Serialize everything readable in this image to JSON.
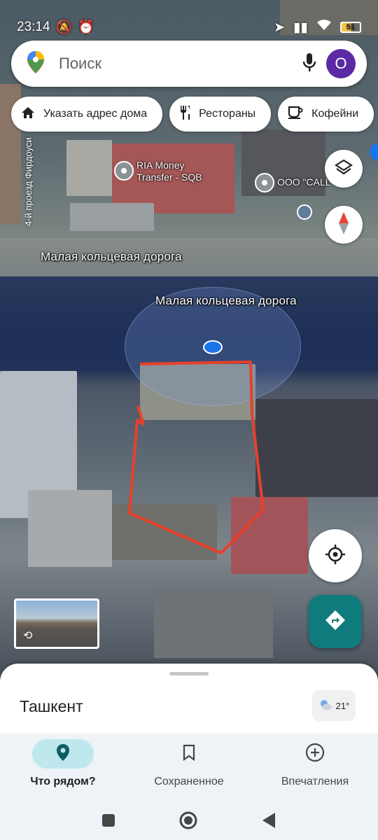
{
  "status_bar": {
    "time": "23:14",
    "battery": "51"
  },
  "search": {
    "placeholder": "Поиск",
    "avatar_letter": "O"
  },
  "chips": [
    {
      "label": "Указать адрес дома",
      "icon": "home-icon"
    },
    {
      "label": "Рестораны",
      "icon": "restaurant-icon"
    },
    {
      "label": "Кофейни",
      "icon": "coffee-icon"
    }
  ],
  "map": {
    "road_label_1": "Малая кольцевая дорога",
    "road_label_2": "Малая кольцевая дорога",
    "side_street": "4-й проезд Фирдоуси",
    "poi_1": "RIA Money Transfer - SQB",
    "poi_2": "ООО \"CALL",
    "colors": {
      "outline": "#e8402a",
      "route_button": "#0f7b7d",
      "location_dot": "#1a73e8"
    }
  },
  "sheet": {
    "city": "Ташкент",
    "temperature": "21°"
  },
  "bottom_nav": [
    {
      "label": "Что рядом?",
      "icon": "location-pin-icon",
      "active": true
    },
    {
      "label": "Сохраненное",
      "icon": "bookmark-icon",
      "active": false
    },
    {
      "label": "Впечатления",
      "icon": "add-circle-icon",
      "active": false
    }
  ]
}
